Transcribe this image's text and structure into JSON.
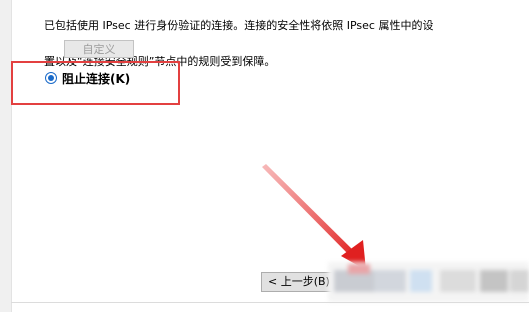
{
  "description_lines": [
    "已包括使用 IPsec 进行身份验证的连接。连接的安全性将依照 IPsec 属性中的设",
    "置以及“连接安全规则”节点中的规则受到保障。"
  ],
  "customize_button": {
    "label": "自定义",
    "enabled": false
  },
  "block_option": {
    "label": "阻止连接(K)",
    "selected": true
  },
  "wizard_buttons": {
    "back_label": "< 上一步(B)"
  },
  "annotation": {
    "highlight_color": "#e34040",
    "arrow_color": "#e02020"
  }
}
